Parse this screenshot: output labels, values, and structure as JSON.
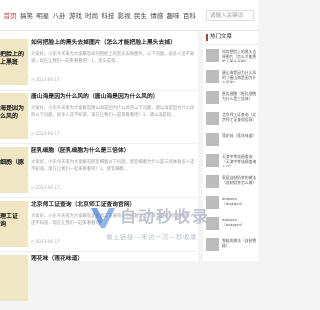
{
  "nav": {
    "items": [
      {
        "label": "首页",
        "active": true
      },
      {
        "label": "搞笑"
      },
      {
        "label": "明星"
      },
      {
        "label": "八卦"
      },
      {
        "label": "游戏"
      },
      {
        "label": "时尚"
      },
      {
        "label": "科技"
      },
      {
        "label": "影视"
      },
      {
        "label": "民生"
      },
      {
        "label": "情感"
      },
      {
        "label": "趣味"
      },
      {
        "label": "百科"
      }
    ],
    "search_placeholder": "请输入关键词"
  },
  "articles": [
    {
      "thumb_text": "把脸上的\n上黑斑",
      "title": "如何把脸上的黑头去掉图片（怎么才能把脸上黑头去掉）",
      "excerpt": "大家好，小乐今天来为大家解答如何把脸上的黑头去掉图片，以下问题，很多人还不知道，现在让我们一起来看看吧！1、黑头是指…",
      "date": "2023-06-17"
    },
    {
      "thumb_text": "海是因为\n么风的",
      "title": "唐山海是因为什么风的（唐山海是因为什么风的）",
      "excerpt": "大家好，小乐今天来为大家解答唐山海是因为什么风的以下问题，唐山海是因为什么风的以下问题，很多人还不知道，现在让我们一起来看看吧！1、唐山海是指…",
      "date": "2023-06-17"
    },
    {
      "thumb_text": "细胞（豚\n",
      "title": "胚乳细胞（胚乳细胞为什么是三倍体）",
      "excerpt": "大家好，小乐今天来为大家解答胚乳细胞以下问题，胚乳细胞为什么是三倍体很多人还不知道，现在让我们一起来看看吧！1、胚乳细胞…",
      "date": "2023-06-17"
    },
    {
      "thumb_text": "理工证\n询",
      "title": "北京师工证查询（北京师工证查询官网）",
      "excerpt": "大家好，小乐今天来为大家解答北京师工证查询以下问题，北京师工证查询官网很多人还不知道，现在让我们一起来看看吧！…",
      "date": "2023-06-17"
    },
    {
      "thumb_text": "",
      "title": "莲花味（莲花味道）",
      "excerpt": "",
      "date": ""
    }
  ],
  "sidebar": {
    "heading": "热门文章",
    "items": [
      {
        "title": "如何把脸上的黑头去掉图片（怎么才能把脸上黑头去掉）"
      },
      {
        "title": "唐山海是因为什么风的（唐山海是因为什么风的）"
      },
      {
        "title": "胚乳细胞（胚乳细胞为什么是三倍体）"
      },
      {
        "title": "北京师工证查询（北京师工证查询官网）"
      },
      {
        "title": "莲花味（莲花味道）"
      },
      {
        "title": "天津中考成绩查询（天津中考成绩查询入口）"
      },
      {
        "title": "家庭自制奶茶的做法（自制奶茶怎么做）"
      },
      {
        "title": "dlqkqxn（dlqkqxn）"
      },
      {
        "title": "dqkjqxn（dqkjqxn）"
      },
      {
        "title": "雪糕的做法（自制雪糕）"
      }
    ]
  },
  "watermark": {
    "title": "自动秒收录",
    "subtitle": "做上链接—来访一次—秒收录"
  },
  "colors": {
    "accent": "#c0392b",
    "thumb_bg": "#efe7c3",
    "watermark_blue": "#3a7bd5"
  }
}
